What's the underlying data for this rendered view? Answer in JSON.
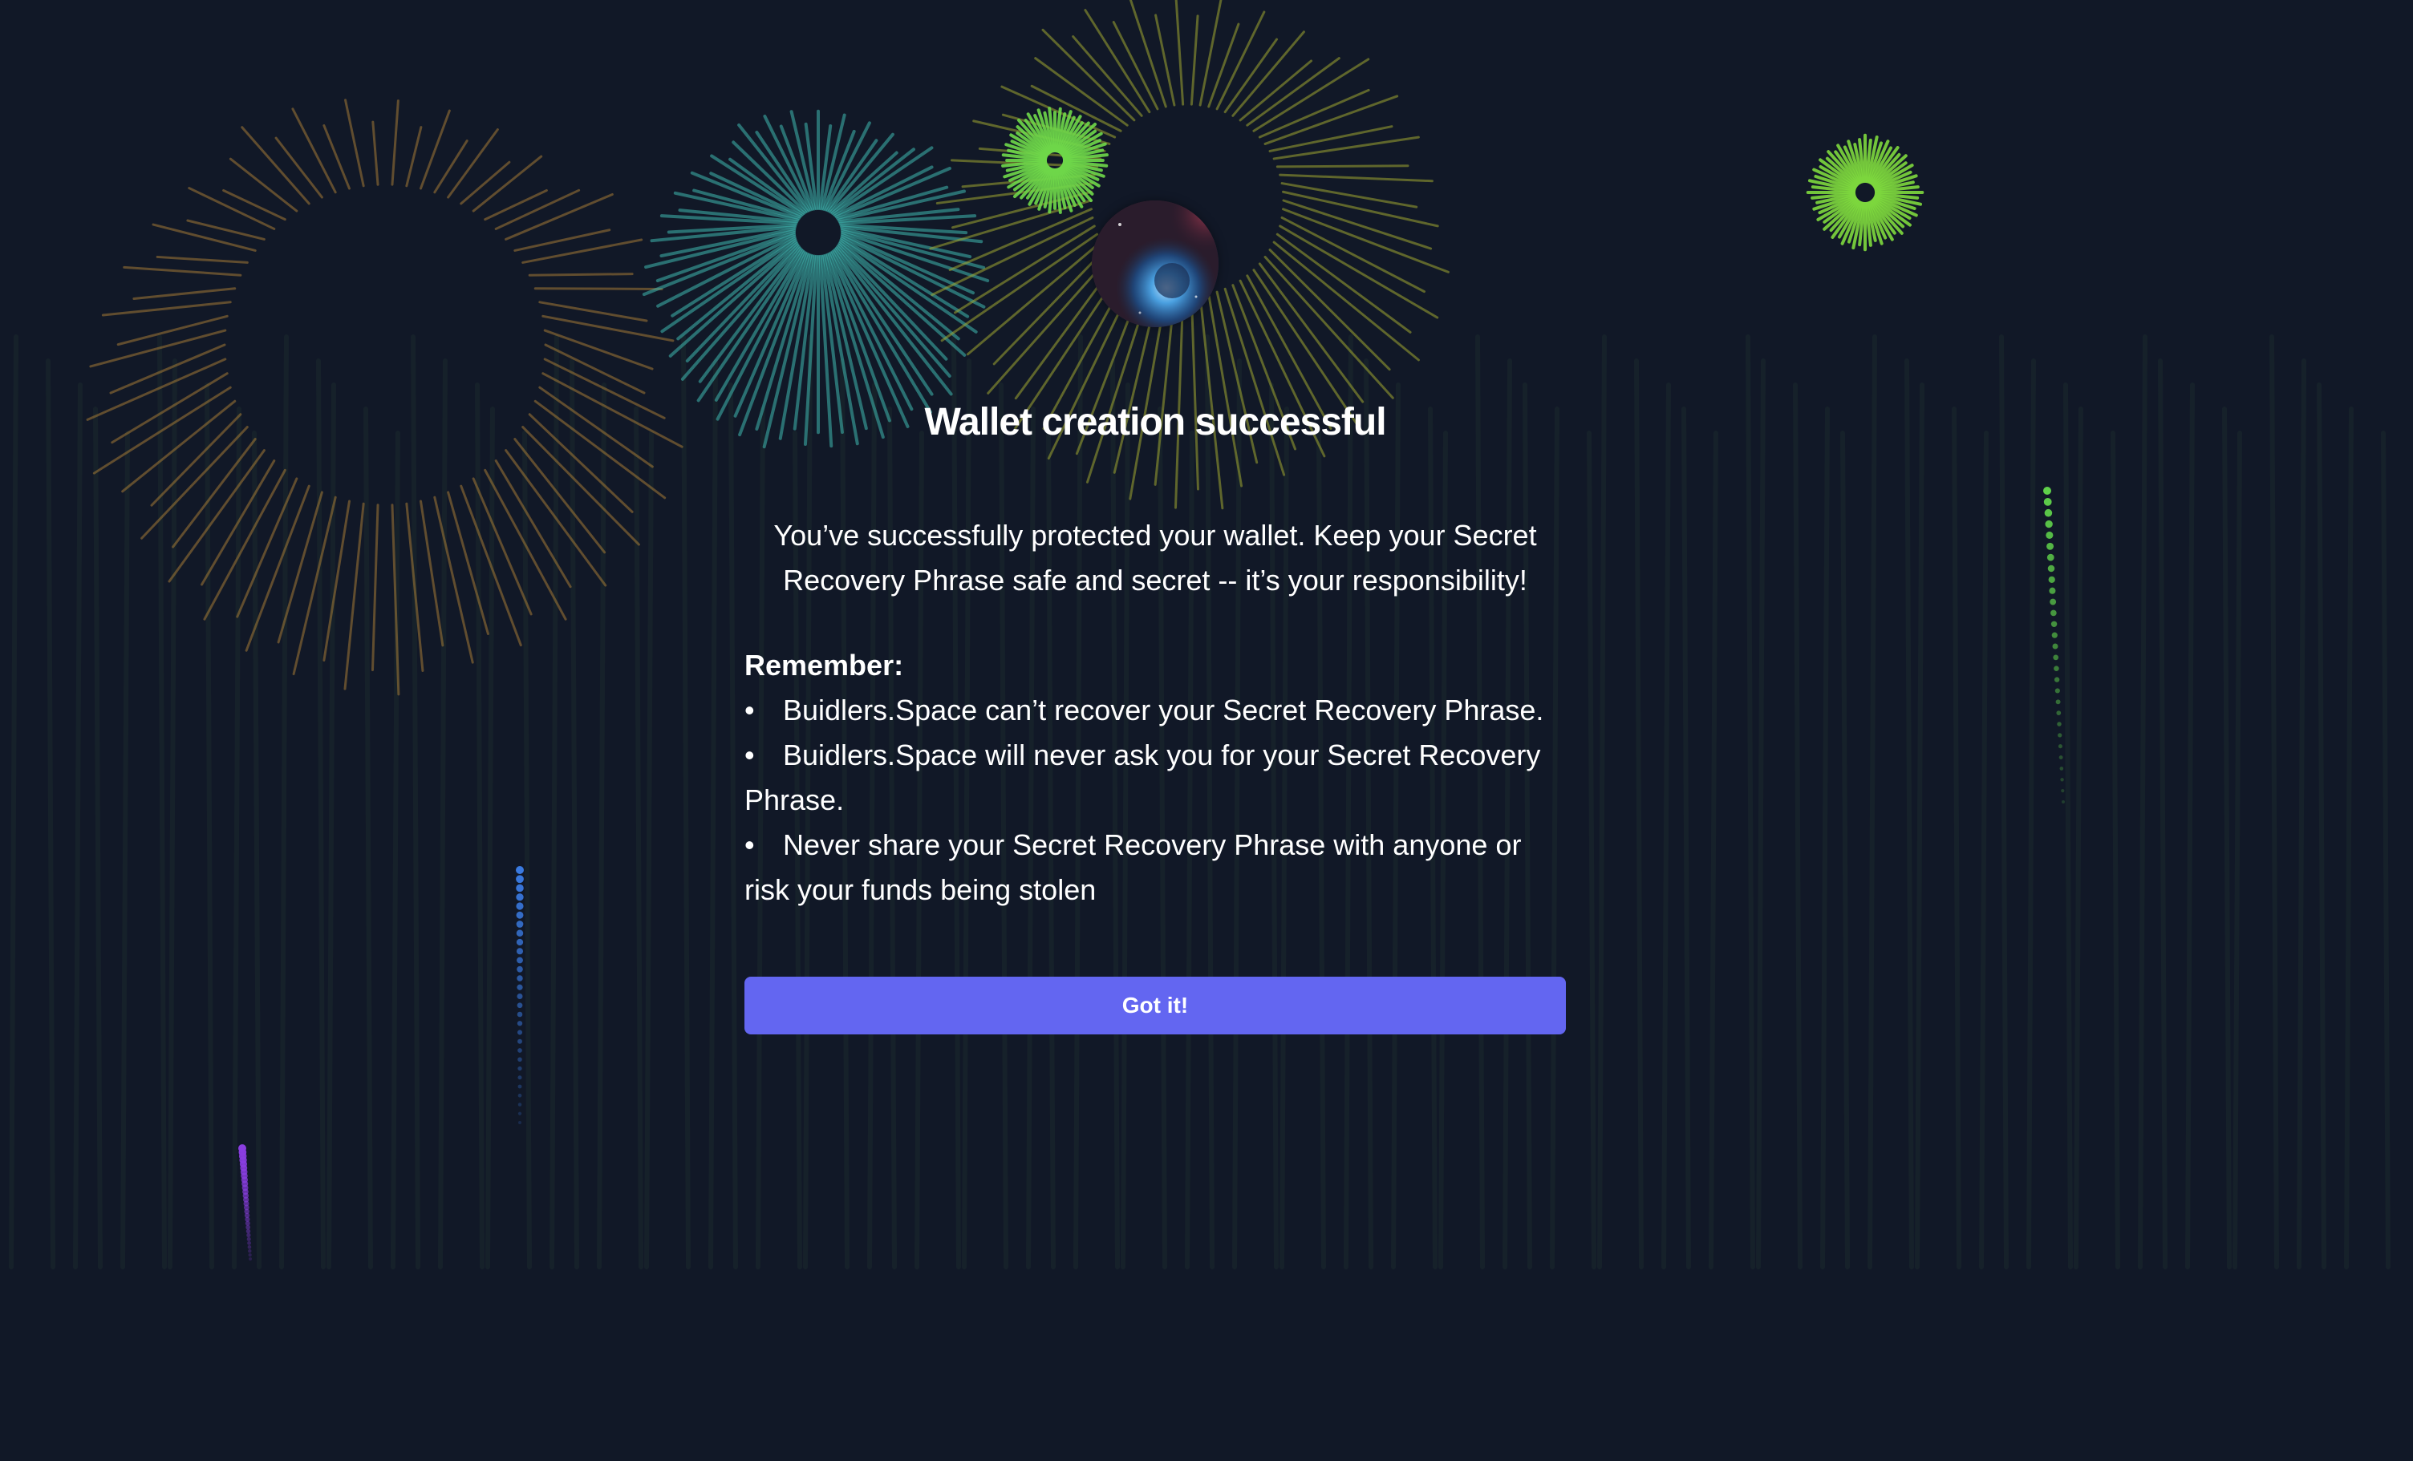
{
  "dialog": {
    "avatar_icon": "nebula-avatar-icon",
    "title": "Wallet creation successful",
    "intro": "You’ve successfully protected your wallet. Keep your Secret Recovery Phrase safe and secret -- it’s your responsibility!",
    "remember_title": "Remember:",
    "rules": [
      "Buidlers.Space can’t recover your Secret Recovery Phrase.",
      "Buidlers.Space will never ask you for your Secret Recovery Phrase.",
      "Never share your Secret Recovery Phrase with anyone or risk your funds being stolen"
    ],
    "button_label": "Got it!"
  },
  "theme": {
    "background": "#111827",
    "accent": "#6366f1",
    "text": "#ffffff"
  },
  "background_effect": "fireworks-animation"
}
